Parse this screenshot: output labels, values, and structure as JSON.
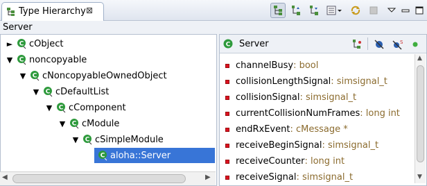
{
  "view": {
    "title": "Type Hierarchy",
    "close_glyph": "⊠",
    "focus_label": "Server"
  },
  "toolbar": {
    "buttons": [
      "show-type-hierarchy-icon",
      "show-supertype-hierarchy-icon",
      "show-subtype-hierarchy-icon",
      "layout-menu-icon",
      "refresh-icon",
      "stop-icon",
      "view-menu-icon",
      "minimize-icon",
      "maximize-icon"
    ]
  },
  "tree": {
    "nodes": [
      {
        "label": "cObject",
        "expanded": false
      },
      {
        "label": "noncopyable",
        "expanded": true
      },
      {
        "label": "cNoncopyableOwnedObject",
        "expanded": true
      },
      {
        "label": "cDefaultList",
        "expanded": true
      },
      {
        "label": "cComponent",
        "expanded": true
      },
      {
        "label": "cModule",
        "expanded": true
      },
      {
        "label": "cSimpleModule",
        "expanded": true
      },
      {
        "label": "aloha::Server",
        "selected": true
      }
    ]
  },
  "members_panel": {
    "title": "Server",
    "members": [
      {
        "name": "channelBusy",
        "type": " : bool"
      },
      {
        "name": "collisionLengthSignal",
        "type": " : simsignal_t"
      },
      {
        "name": "collisionSignal",
        "type": " : simsignal_t"
      },
      {
        "name": "currentCollisionNumFrames",
        "type": " : long int"
      },
      {
        "name": "endRxEvent",
        "type": " : cMessage *"
      },
      {
        "name": "receiveBeginSignal",
        "type": " : simsignal_t"
      },
      {
        "name": "receiveCounter",
        "type": " : long int"
      },
      {
        "name": "receiveSignal",
        "type": " : simsignal_t"
      }
    ]
  },
  "colors": {
    "selection": "#3875d7",
    "class_icon": "#2e9a3c",
    "field_icon": "#d12222",
    "type_text": "#8b6b2e"
  }
}
